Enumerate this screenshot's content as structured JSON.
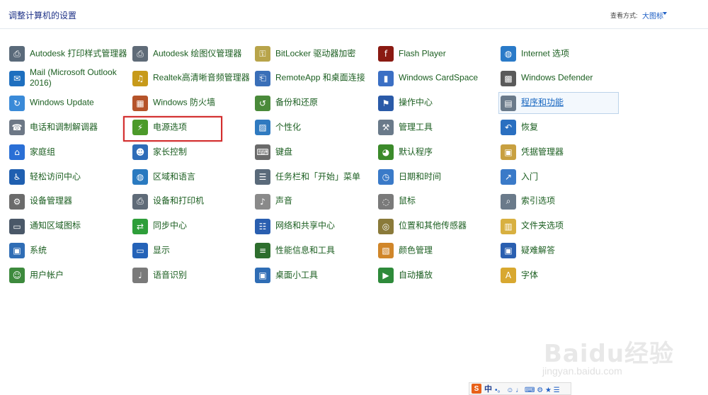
{
  "header": {
    "title": "调整计算机的设置",
    "view_by_label": "查看方式:",
    "view_by_value": "大图标"
  },
  "items": [
    {
      "label": "Autodesk 打印样式管理器",
      "icon": "printer-style-icon",
      "color": "#5a6a7a",
      "glyph": "⎙"
    },
    {
      "label": "Mail (Microsoft Outlook 2016)",
      "icon": "mail-icon",
      "color": "#1e6fbf",
      "glyph": "✉"
    },
    {
      "label": "Windows Update",
      "icon": "windows-update-icon",
      "color": "#3a8ad8",
      "glyph": "↻"
    },
    {
      "label": "电话和调制解调器",
      "icon": "phone-modem-icon",
      "color": "#6d7886",
      "glyph": "☎"
    },
    {
      "label": "家庭组",
      "icon": "homegroup-icon",
      "color": "#2a6fd6",
      "glyph": "⌂"
    },
    {
      "label": "轻松访问中心",
      "icon": "ease-of-access-icon",
      "color": "#1f5fb0",
      "glyph": "♿"
    },
    {
      "label": "设备管理器",
      "icon": "device-manager-icon",
      "color": "#6b6b6b",
      "glyph": "⚙"
    },
    {
      "label": "通知区域图标",
      "icon": "notification-area-icon",
      "color": "#4a5868",
      "glyph": "▭"
    },
    {
      "label": "系统",
      "icon": "system-icon",
      "color": "#2f6db5",
      "glyph": "▣"
    },
    {
      "label": "用户帐户",
      "icon": "user-accounts-icon",
      "color": "#3d8a3d",
      "glyph": "☺"
    },
    {
      "label": "Autodesk 绘图仪管理器",
      "icon": "plotter-manager-icon",
      "color": "#5f6b78",
      "glyph": "⎙"
    },
    {
      "label": "Realtek高清晰音频管理器",
      "icon": "realtek-audio-icon",
      "color": "#c79a1a",
      "glyph": "♫"
    },
    {
      "label": "Windows 防火墙",
      "icon": "firewall-icon",
      "color": "#b5532a",
      "glyph": "▦"
    },
    {
      "label": "电源选项",
      "icon": "power-options-icon",
      "color": "#4c9a2a",
      "glyph": "⚡"
    },
    {
      "label": "家长控制",
      "icon": "parental-controls-icon",
      "color": "#2e6cb8",
      "glyph": "☻"
    },
    {
      "label": "区域和语言",
      "icon": "region-language-icon",
      "color": "#2a7ac0",
      "glyph": "◍"
    },
    {
      "label": "设备和打印机",
      "icon": "devices-printers-icon",
      "color": "#5f6b78",
      "glyph": "⎙"
    },
    {
      "label": "同步中心",
      "icon": "sync-center-icon",
      "color": "#2e9e3a",
      "glyph": "⇄"
    },
    {
      "label": "显示",
      "icon": "display-icon",
      "color": "#2563b8",
      "glyph": "▭"
    },
    {
      "label": "语音识别",
      "icon": "speech-recognition-icon",
      "color": "#7a7a7a",
      "glyph": "♩"
    },
    {
      "label": "BitLocker 驱动器加密",
      "icon": "bitlocker-icon",
      "color": "#b8a44a",
      "glyph": "⚿"
    },
    {
      "label": "RemoteApp 和桌面连接",
      "icon": "remoteapp-icon",
      "color": "#3a6fb8",
      "glyph": "⎗"
    },
    {
      "label": "备份和还原",
      "icon": "backup-restore-icon",
      "color": "#4a8a3a",
      "glyph": "↺"
    },
    {
      "label": "个性化",
      "icon": "personalization-icon",
      "color": "#2f7ac0",
      "glyph": "▨"
    },
    {
      "label": "键盘",
      "icon": "keyboard-icon",
      "color": "#6a6a6a",
      "glyph": "⌨"
    },
    {
      "label": "任务栏和「开始」菜单",
      "icon": "taskbar-start-icon",
      "color": "#5a6a7a",
      "glyph": "☰"
    },
    {
      "label": "声音",
      "icon": "sound-icon",
      "color": "#8a8a8a",
      "glyph": "♪"
    },
    {
      "label": "网络和共享中心",
      "icon": "network-sharing-icon",
      "color": "#2a5fb0",
      "glyph": "☷"
    },
    {
      "label": "性能信息和工具",
      "icon": "performance-icon",
      "color": "#2e6e2e",
      "glyph": "≡"
    },
    {
      "label": "桌面小工具",
      "icon": "desktop-gadgets-icon",
      "color": "#2f6db5",
      "glyph": "▣"
    },
    {
      "label": "Flash Player",
      "icon": "flash-player-icon",
      "color": "#8a1a12",
      "glyph": "f"
    },
    {
      "label": "Windows CardSpace",
      "icon": "cardspace-icon",
      "color": "#3b6fc4",
      "glyph": "▮"
    },
    {
      "label": "操作中心",
      "icon": "action-center-icon",
      "color": "#2a5aa8",
      "glyph": "⚑"
    },
    {
      "label": "管理工具",
      "icon": "admin-tools-icon",
      "color": "#6a7a8a",
      "glyph": "⚒"
    },
    {
      "label": "默认程序",
      "icon": "default-programs-icon",
      "color": "#3b8a2a",
      "glyph": "◕"
    },
    {
      "label": "日期和时间",
      "icon": "date-time-icon",
      "color": "#3a7ac8",
      "glyph": "◷"
    },
    {
      "label": "鼠标",
      "icon": "mouse-icon",
      "color": "#7a7a7a",
      "glyph": "◌"
    },
    {
      "label": "位置和其他传感器",
      "icon": "location-sensors-icon",
      "color": "#8a7a3a",
      "glyph": "◎"
    },
    {
      "label": "颜色管理",
      "icon": "color-management-icon",
      "color": "#d0862a",
      "glyph": "▧"
    },
    {
      "label": "自动播放",
      "icon": "autoplay-icon",
      "color": "#2e8a3a",
      "glyph": "▶"
    },
    {
      "label": "Internet 选项",
      "icon": "internet-options-icon",
      "color": "#2a7ac8",
      "glyph": "◍"
    },
    {
      "label": "Windows Defender",
      "icon": "windows-defender-icon",
      "color": "#5a5a5a",
      "glyph": "▩"
    },
    {
      "label": "程序和功能",
      "icon": "programs-features-icon",
      "color": "#6a7a8a",
      "glyph": "▤"
    },
    {
      "label": "恢复",
      "icon": "recovery-icon",
      "color": "#2a6fc0",
      "glyph": "↶"
    },
    {
      "label": "凭据管理器",
      "icon": "credential-manager-icon",
      "color": "#c8a040",
      "glyph": "▣"
    },
    {
      "label": "入门",
      "icon": "getting-started-icon",
      "color": "#3a7ac8",
      "glyph": "↗"
    },
    {
      "label": "索引选项",
      "icon": "indexing-options-icon",
      "color": "#6a7a8a",
      "glyph": "⌕"
    },
    {
      "label": "文件夹选项",
      "icon": "folder-options-icon",
      "color": "#d8b040",
      "glyph": "▥"
    },
    {
      "label": "疑难解答",
      "icon": "troubleshooting-icon",
      "color": "#2a5fb0",
      "glyph": "▣"
    },
    {
      "label": "字体",
      "icon": "fonts-icon",
      "color": "#d8a830",
      "glyph": "A"
    }
  ],
  "watermark": {
    "logo": "Baidu经验",
    "url": "jingyan.baidu.com"
  },
  "ime": {
    "s": "S",
    "mode": "中",
    "symbols": "•。 ☺ ♩ ⌨ ⚙ ★ ☰"
  }
}
